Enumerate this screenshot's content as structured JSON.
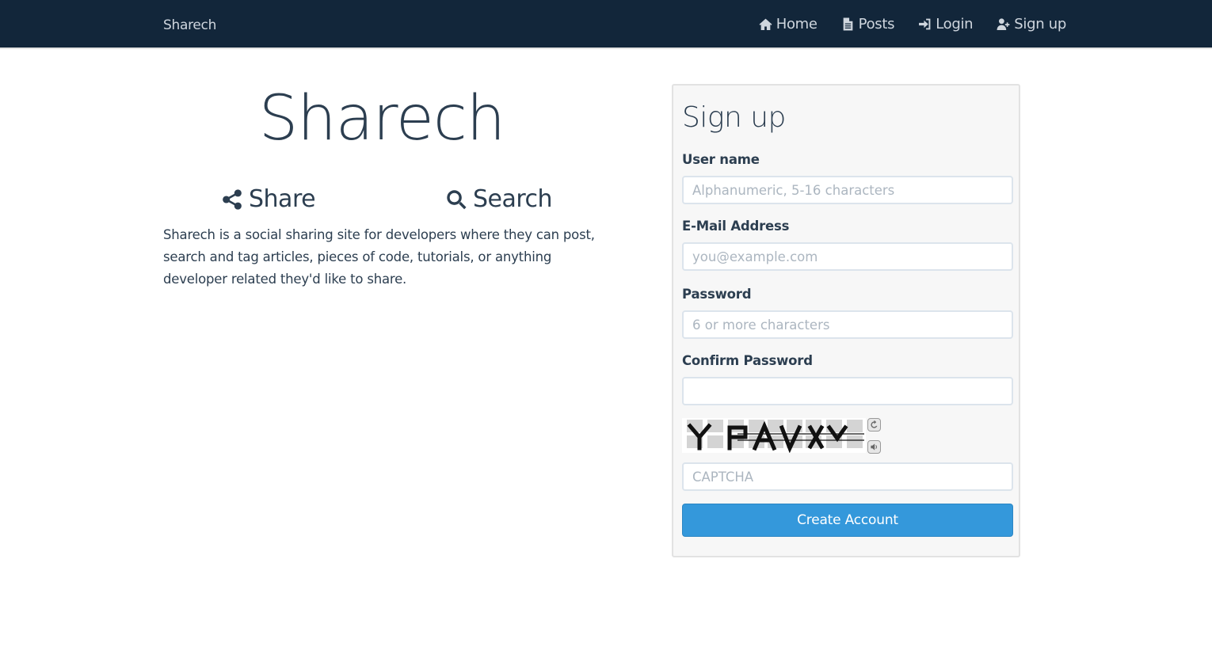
{
  "navbar": {
    "brand": "Sharech",
    "items": [
      {
        "label": "Home",
        "icon": "home-icon"
      },
      {
        "label": "Posts",
        "icon": "file-icon"
      },
      {
        "label": "Login",
        "icon": "sign-in-icon"
      },
      {
        "label": "Sign up",
        "icon": "user-plus-icon"
      }
    ]
  },
  "hero": {
    "title": "Sharech",
    "features": [
      {
        "label": "Share",
        "icon": "share-icon"
      },
      {
        "label": "Search",
        "icon": "search-icon"
      }
    ],
    "description": "Sharech is a social sharing site for developers where they can post, search and tag articles, pieces of code, tutorials, or anything developer related they'd like to share."
  },
  "signup": {
    "heading": "Sign up",
    "fields": [
      {
        "label": "User name",
        "placeholder": "Alphanumeric, 5-16 characters",
        "value": ""
      },
      {
        "label": "E-Mail Address",
        "placeholder": "you@example.com",
        "value": ""
      },
      {
        "label": "Password",
        "placeholder": "6 or more characters",
        "value": ""
      },
      {
        "label": "Confirm Password",
        "placeholder": "",
        "value": ""
      }
    ],
    "captcha": {
      "placeholder": "CAPTCHA",
      "refresh_icon": "refresh-icon",
      "audio_icon": "audio-icon"
    },
    "submit_label": "Create Account"
  },
  "colors": {
    "navbar_bg": "#12263a",
    "text": "#2c3e50",
    "primary": "#3498db"
  }
}
